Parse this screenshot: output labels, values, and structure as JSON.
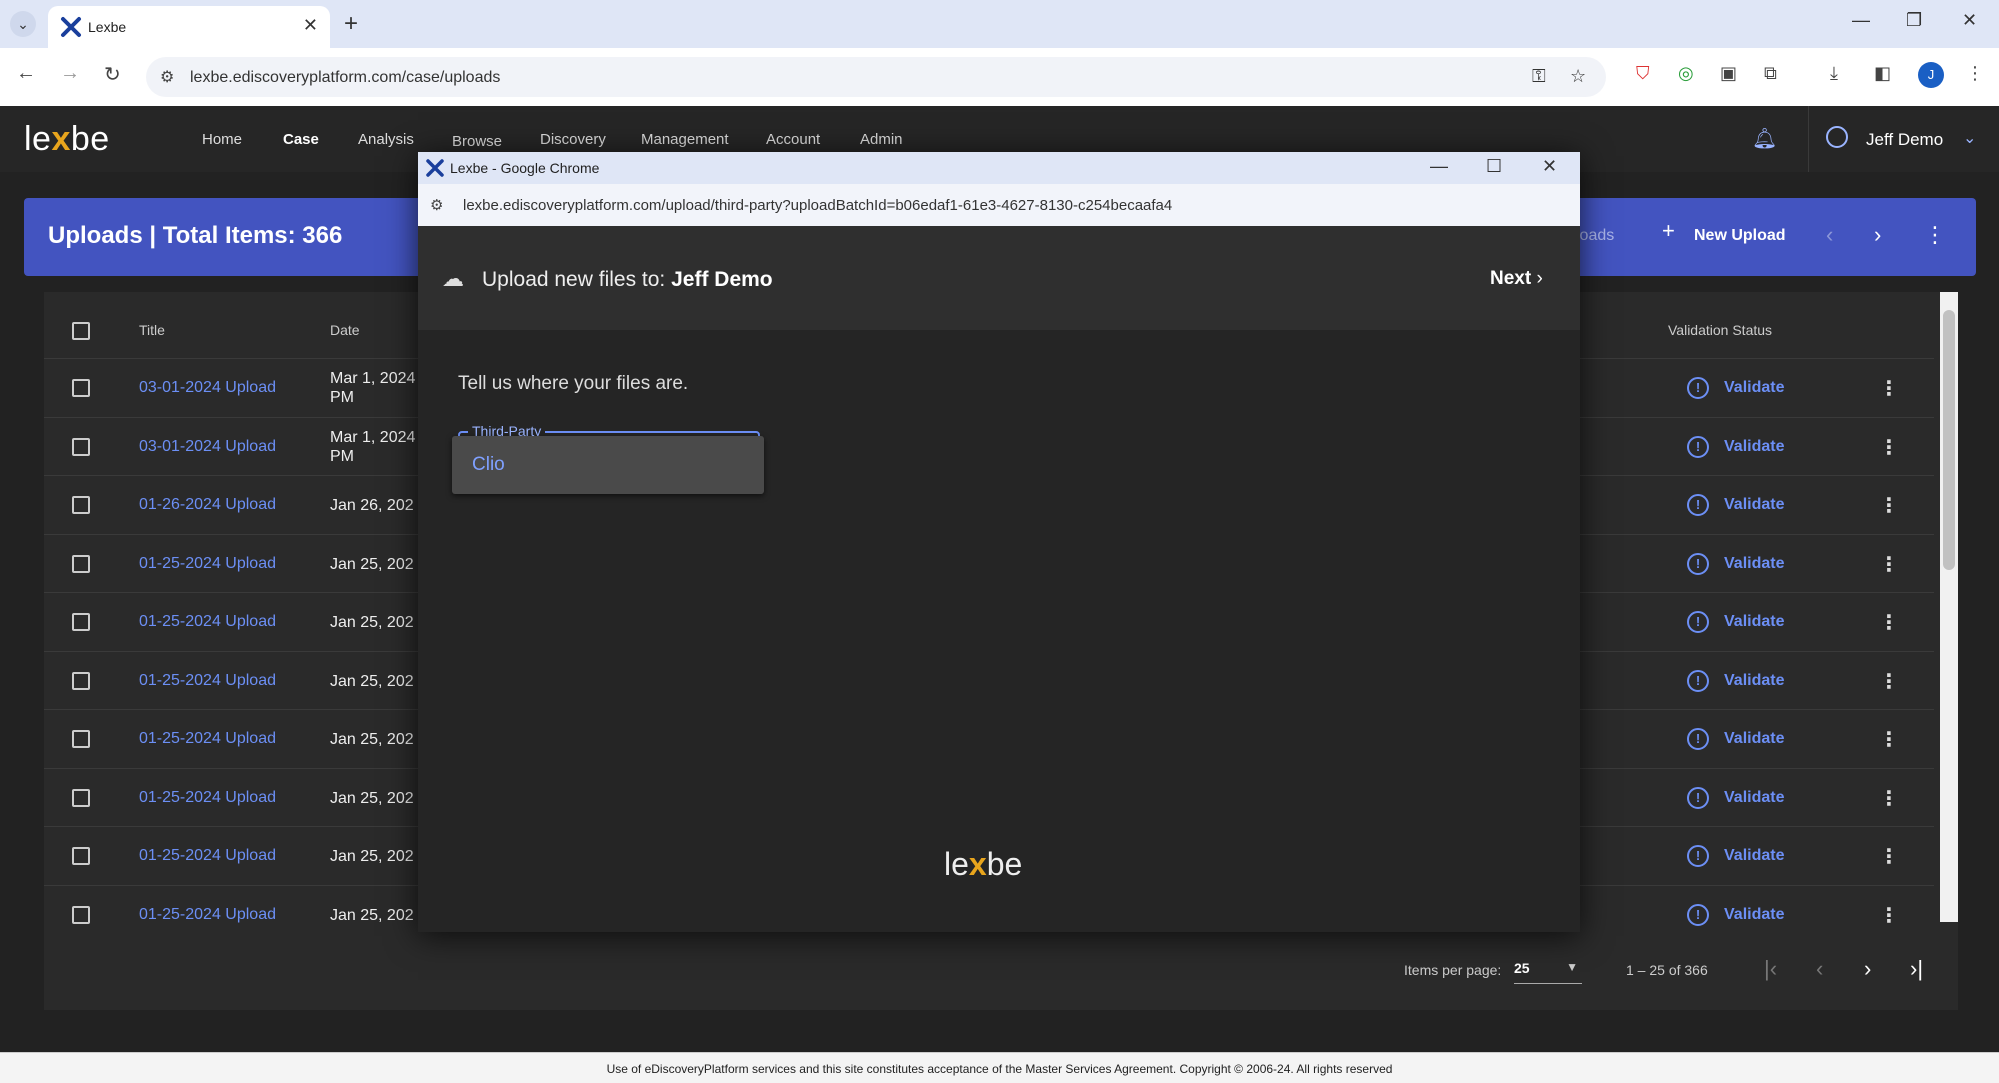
{
  "browser": {
    "tab_title": "Lexbe",
    "url": "lexbe.ediscoveryplatform.com/case/uploads"
  },
  "app": {
    "brand_pre": "le",
    "brand_x": "x",
    "brand_post": "be",
    "nav": [
      "Home",
      "Case",
      "Analysis",
      "Browse",
      "Discovery",
      "Management",
      "Account",
      "Admin"
    ],
    "user_name": "Jeff Demo"
  },
  "uploads": {
    "title": "Uploads | Total Items: 366",
    "header_partial": "loads",
    "new_upload": "New Upload",
    "columns": {
      "title": "Title",
      "date": "Date",
      "validation": "Validation Status"
    },
    "rows": [
      {
        "title": "03-01-2024 Upload",
        "date": "Mar 1, 2024",
        "date2": "PM",
        "validate": "Validate"
      },
      {
        "title": "03-01-2024 Upload",
        "date": "Mar 1, 2024",
        "date2": "PM",
        "validate": "Validate"
      },
      {
        "title": "01-26-2024 Upload",
        "date": "Jan 26, 202",
        "date2": "",
        "validate": "Validate"
      },
      {
        "title": "01-25-2024 Upload",
        "date": "Jan 25, 202",
        "date2": "",
        "validate": "Validate"
      },
      {
        "title": "01-25-2024 Upload",
        "date": "Jan 25, 202",
        "date2": "",
        "validate": "Validate"
      },
      {
        "title": "01-25-2024 Upload",
        "date": "Jan 25, 202",
        "date2": "",
        "validate": "Validate"
      },
      {
        "title": "01-25-2024 Upload",
        "date": "Jan 25, 202",
        "date2": "",
        "validate": "Validate"
      },
      {
        "title": "01-25-2024 Upload",
        "date": "Jan 25, 202",
        "date2": "",
        "validate": "Validate"
      },
      {
        "title": "01-25-2024 Upload",
        "date": "Jan 25, 202",
        "date2": "",
        "validate": "Validate"
      },
      {
        "title": "01-25-2024 Upload",
        "date": "Jan 25, 202",
        "date2": "",
        "validate": "Validate"
      }
    ],
    "pager": {
      "items_per_page_label": "Items per page:",
      "items_per_page": "25",
      "range": "1 – 25 of 366"
    }
  },
  "footer": "Use of eDiscoveryPlatform services and this site constitutes acceptance of the Master Services Agreement. Copyright © 2006-24. All rights reserved",
  "popup": {
    "window_title": "Lexbe - Google Chrome",
    "url": "lexbe.ediscoveryplatform.com/upload/third-party?uploadBatchId=b06edaf1-61e3-4627-8130-c254becaafa4",
    "heading_prefix": "Upload new files to: ",
    "heading_target": "Jeff Demo",
    "next": "Next",
    "prompt": "Tell us where your files are.",
    "field_label": "Third-Party",
    "option": "Clio"
  },
  "colors": {
    "accent": "#4354c0",
    "link": "#6c8ff5",
    "brand_x": "#e8a51d"
  }
}
